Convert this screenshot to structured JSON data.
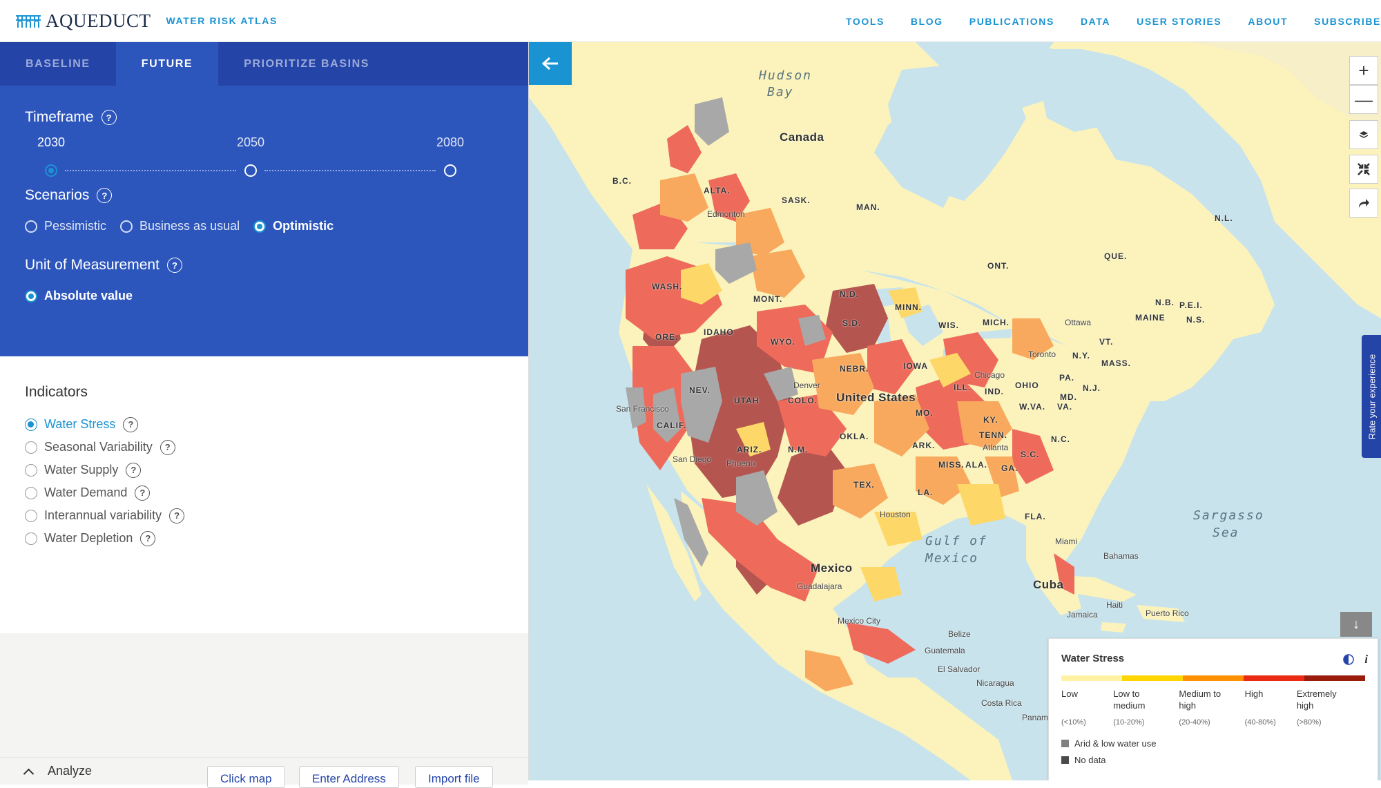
{
  "header": {
    "logo_text": "AQUEDUCT",
    "subtitle": "WATER RISK ATLAS",
    "nav": [
      "TOOLS",
      "BLOG",
      "PUBLICATIONS",
      "DATA",
      "USER STORIES",
      "ABOUT",
      "SUBSCRIBE"
    ]
  },
  "sidebar": {
    "tabs": [
      {
        "label": "BASELINE",
        "active": false
      },
      {
        "label": "FUTURE",
        "active": true
      },
      {
        "label": "PRIORITIZE BASINS",
        "active": false
      }
    ],
    "timeframe": {
      "title": "Timeframe",
      "help": "?",
      "options": [
        "2030",
        "2050",
        "2080"
      ],
      "selected": "2030"
    },
    "scenarios": {
      "title": "Scenarios",
      "help": "?",
      "options": [
        "Pessimistic",
        "Business as usual",
        "Optimistic"
      ],
      "selected": "Optimistic"
    },
    "unit": {
      "title": "Unit of Measurement",
      "help": "?",
      "options": [
        "Absolute value"
      ],
      "selected": "Absolute value"
    },
    "indicators": {
      "title": "Indicators",
      "help": "?",
      "items": [
        "Water Stress",
        "Seasonal Variability",
        "Water Supply",
        "Water Demand",
        "Interannual variability",
        "Water Depletion"
      ],
      "selected": "Water Stress"
    },
    "analyze": {
      "label": "Analyze",
      "buttons": [
        "Click map",
        "Enter Address",
        "Import file"
      ]
    }
  },
  "map": {
    "rate_tab": "Rate your experience",
    "zoom_in": "+",
    "zoom_out": "—",
    "legend_toggle": "↓",
    "labels": {
      "hudson": "Hudson",
      "bay": "Bay",
      "canada": "Canada",
      "bc": "B.C.",
      "alta": "ALTA.",
      "sask": "SASK.",
      "man": "MAN.",
      "edmonton": "Edmonton",
      "nl": "N.L.",
      "que": "QUE.",
      "ont": "ONT.",
      "wash": "WASH.",
      "mont": "MONT.",
      "nd": "N.D.",
      "minn": "MINN.",
      "ore": "ORE.",
      "idaho": "IDAHO",
      "wyo": "WYO.",
      "sd": "S.D.",
      "wis": "WIS.",
      "mich": "MICH.",
      "ottawa": "Ottawa",
      "maine": "MAINE",
      "nb": "N.B.",
      "pei": "P.E.I.",
      "ns": "N.S.",
      "vt": "VT.",
      "ny": "N.Y.",
      "mass": "MASS.",
      "toronto": "Toronto",
      "nebr": "NEBR.",
      "iowa": "IOWA",
      "nev": "NEV.",
      "utah": "UTAH",
      "denver": "Denver",
      "colo": "COLO.",
      "us": "United States",
      "chicago": "Chicago",
      "ill": "ILL.",
      "ind": "IND.",
      "ohio": "OHIO",
      "pa": "PA.",
      "nj": "N.J.",
      "md": "MD.",
      "wva": "W.VA.",
      "va": "VA.",
      "sf": "San Francisco",
      "calif": "CALIF.",
      "mo": "MO.",
      "ky": "KY.",
      "tenn": "TENN.",
      "nc": "N.C.",
      "okla": "OKLA.",
      "ark": "ARK.",
      "atlanta": "Atlanta",
      "sc": "S.C.",
      "sandiego": "San Diego",
      "ariz": "ARIZ.",
      "nm": "N.M.",
      "phoenix": "Phoenix",
      "miss": "MISS.",
      "ala": "ALA.",
      "ga": "GA.",
      "tex": "TEX.",
      "la": "LA.",
      "houston": "Houston",
      "fla": "FLA.",
      "sargasso": "Sargasso",
      "sea": "Sea",
      "gulfof": "Gulf of",
      "mexico_w": "Mexico",
      "miami": "Miami",
      "bahamas": "Bahamas",
      "mexico": "Mexico",
      "cuba": "Cuba",
      "guadalajara": "Guadalajara",
      "haiti": "Haiti",
      "jamaica": "Jamaica",
      "puertorico": "Puerto Rico",
      "mexicocity": "Mexico City",
      "belize": "Belize",
      "guatemala": "Guatemala",
      "elsalvador": "El Salvador",
      "nicaragua": "Nicaragua",
      "costarica": "Costa Rica",
      "panama": "Panam"
    },
    "legend": {
      "title": "Water Stress",
      "categories": [
        {
          "label": "Low",
          "range": "(<10%)",
          "color": "#fff3a3"
        },
        {
          "label": "Low to medium",
          "range": "(10-20%)",
          "color": "#ffd500"
        },
        {
          "label": "Medium to high",
          "range": "(20-40%)",
          "color": "#ff9100"
        },
        {
          "label": "High",
          "range": "(40-80%)",
          "color": "#ea2a12"
        },
        {
          "label": "Extremely high",
          "range": "(>80%)",
          "color": "#991c0d"
        }
      ],
      "extras": [
        {
          "label": "Arid & low water use",
          "color": "#808080"
        },
        {
          "label": "No data",
          "color": "#4a4a4a"
        }
      ]
    }
  },
  "colors": {
    "accent": "#1a93d2",
    "panel_blue": "#2d56bd",
    "tab_blue": "#2444a8"
  }
}
